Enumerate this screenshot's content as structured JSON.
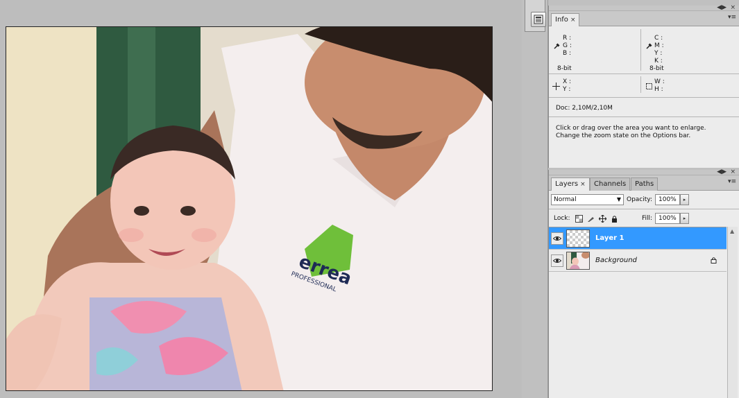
{
  "canvas": {
    "photo_logo_text": "errea",
    "photo_logo_sub": "PROFESSIONAL"
  },
  "info_panel": {
    "tab_label": "Info",
    "close_glyph": "×",
    "rgb_labels": [
      "R :",
      "G :",
      "B :"
    ],
    "cmyk_labels": [
      "C :",
      "M :",
      "Y :",
      "K :"
    ],
    "left_bitdepth": "8-bit",
    "right_bitdepth": "8-bit",
    "xy_labels": [
      "X :",
      "Y :"
    ],
    "wh_labels": [
      "W :",
      "H :"
    ],
    "doc_size": "Doc: 2,10M/2,10M",
    "hint_line1": "Click or drag over the area you want to enlarge.",
    "hint_line2": "Change the zoom state on the Options bar."
  },
  "layers_panel": {
    "tabs": [
      {
        "label": "Layers"
      },
      {
        "label": "Channels"
      },
      {
        "label": "Paths"
      }
    ],
    "close_glyph": "×",
    "blend_mode": "Normal",
    "opacity_label": "Opacity:",
    "opacity_value": "100%",
    "lock_label": "Lock:",
    "fill_label": "Fill:",
    "fill_value": "100%",
    "layers": [
      {
        "name": "Layer 1",
        "selected": true
      },
      {
        "name": "Background",
        "selected": false,
        "locked": true
      }
    ]
  },
  "window_controls": {
    "minimize": "◀▶",
    "close": "×",
    "menu": "▾≡"
  },
  "colors": {
    "selection": "#3399ff",
    "panel_bg": "#ececec",
    "workspace": "#bdbdbd"
  }
}
